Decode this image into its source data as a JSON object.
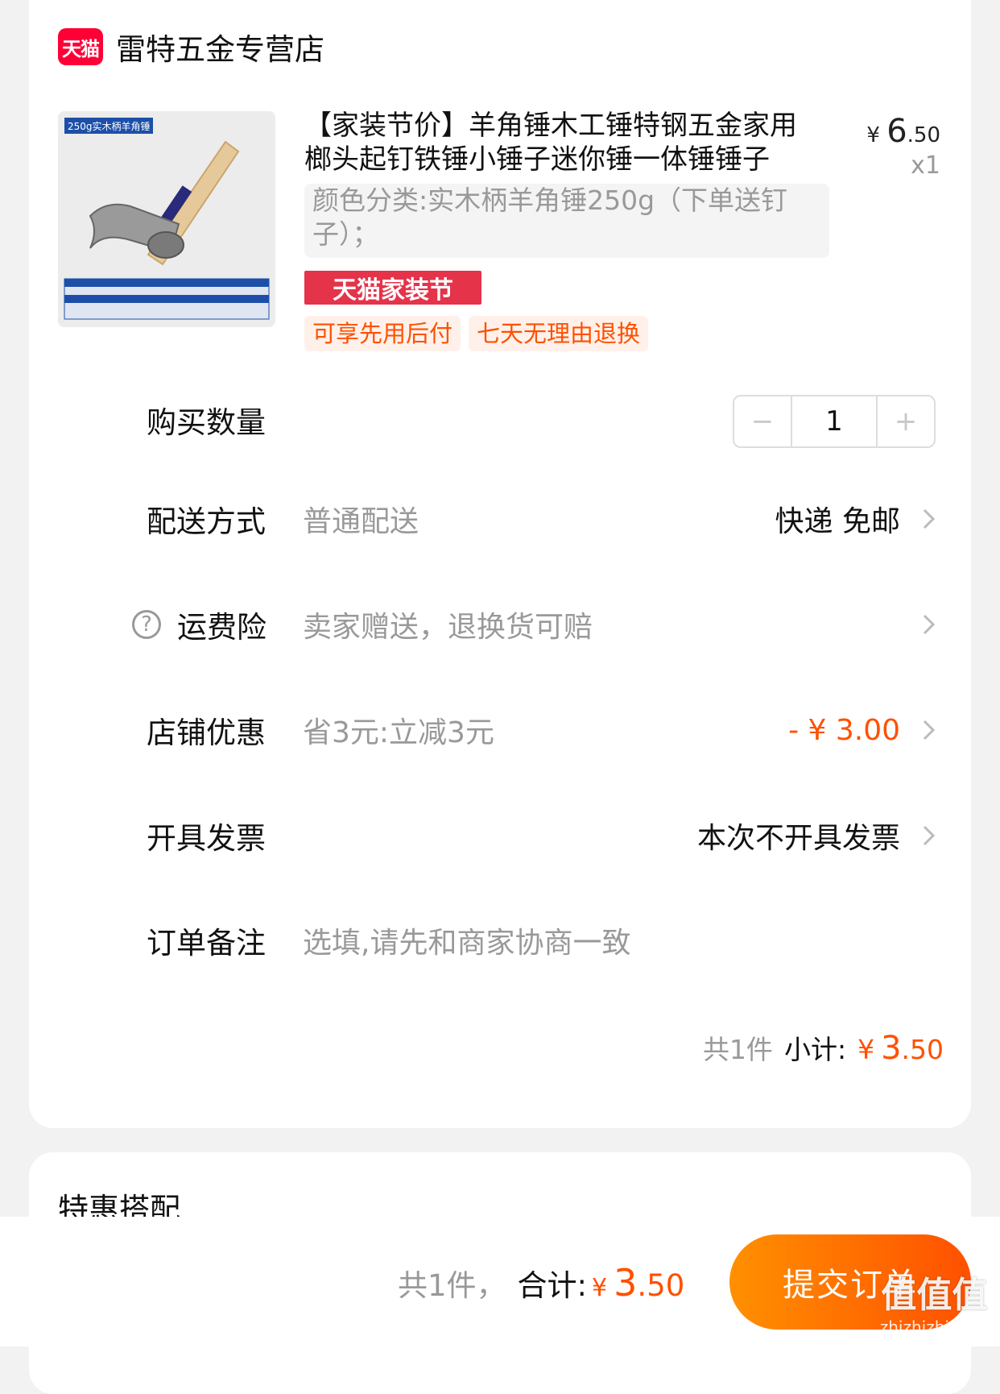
{
  "shop": {
    "logo_text": "天猫",
    "name": "雷特五金专营店"
  },
  "product": {
    "image_label": "250g实木柄羊角锤",
    "title": "【家装节价】羊角锤木工锤特钢五金家用榔头起钉铁锤小锤子迷你锤一体锤锤子",
    "price_yen": "¥",
    "price_int": "6",
    "price_dec": ".50",
    "quantity_label": "x1",
    "sku": "颜色分类:实木柄羊角锤250g（下单送钉子）；",
    "promo_banner": "天猫家装节",
    "tags": [
      "可享先用后付",
      "七天无理由退换"
    ]
  },
  "rows": {
    "quantity": {
      "label": "购买数量",
      "minus": "−",
      "value": "1",
      "plus": "+"
    },
    "delivery": {
      "label": "配送方式",
      "value": "普通配送",
      "right": "快递 免邮"
    },
    "freight_insurance": {
      "help": "?",
      "label": "运费险",
      "value": "卖家赠送，退换货可赔"
    },
    "store_discount": {
      "label": "店铺优惠",
      "value": "省3元:立减3元",
      "right": "- ¥ 3.00"
    },
    "invoice": {
      "label": "开具发票",
      "right": "本次不开具发票"
    },
    "note": {
      "label": "订单备注",
      "placeholder": "选填,请先和商家协商一致"
    }
  },
  "subtotal": {
    "count": "共1件",
    "label": "小计:",
    "yen": "¥",
    "int": "3",
    "dec": ".50"
  },
  "combo": {
    "title": "特惠搭配"
  },
  "bottom": {
    "count": "共1件，",
    "label": "合计:",
    "yen": "¥",
    "int": "3",
    "dec": ".50",
    "submit": "提交订单"
  },
  "watermark": {
    "main": "值值值",
    "sub": "zhizhizhi.com"
  },
  "colors": {
    "accent": "#ff5000",
    "tmall_red": "#ff0036",
    "banner_red": "#e5334a"
  }
}
